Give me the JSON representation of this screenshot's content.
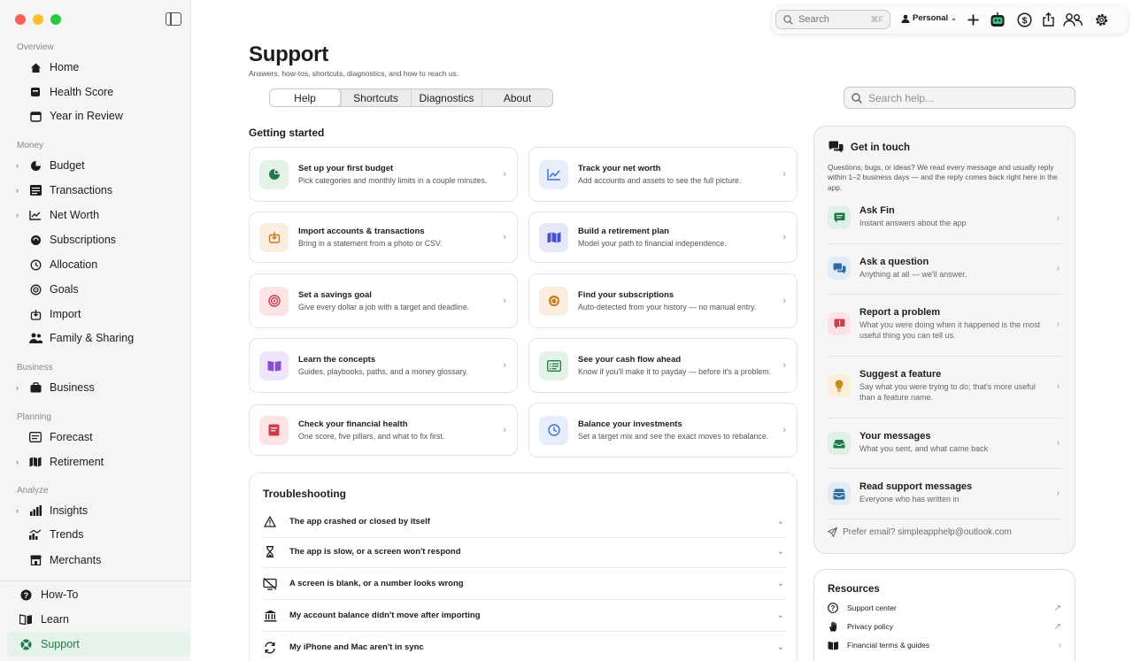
{
  "window": {
    "title": "Support"
  },
  "toolbar": {
    "search_label": "Search",
    "search_shortcut": "⌘F",
    "profile_label": "Personal"
  },
  "sidebar": {
    "sections": {
      "overview": "Overview",
      "money": "Money",
      "business": "Business",
      "planning": "Planning",
      "analyze": "Analyze"
    },
    "items": {
      "home": "Home",
      "health_score": "Health Score",
      "year_in_review": "Year in Review",
      "budget": "Budget",
      "transactions": "Transactions",
      "net_worth": "Net Worth",
      "subscriptions": "Subscriptions",
      "allocation": "Allocation",
      "goals": "Goals",
      "import": "Import",
      "family_sharing": "Family & Sharing",
      "business": "Business",
      "forecast": "Forecast",
      "retirement": "Retirement",
      "insights": "Insights",
      "trends": "Trends",
      "merchants": "Merchants"
    },
    "bottom": {
      "how_to": "How-To",
      "learn": "Learn",
      "support": "Support"
    }
  },
  "page": {
    "title": "Support",
    "subtitle": "Answers, how-tos, shortcuts, diagnostics, and how to reach us.",
    "tabs": [
      "Help",
      "Shortcuts",
      "Diagnostics",
      "About"
    ],
    "active_tab": "Help",
    "search_placeholder": "Search help..."
  },
  "getting_started": {
    "title": "Getting started",
    "cards": [
      {
        "title": "Set up your first budget",
        "desc": "Pick categories and monthly limits in a couple minutes."
      },
      {
        "title": "Track your net worth",
        "desc": "Add accounts and assets to see the full picture."
      },
      {
        "title": "Import accounts & transactions",
        "desc": "Bring in a statement from a photo or CSV."
      },
      {
        "title": "Build a retirement plan",
        "desc": "Model your path to financial independence."
      },
      {
        "title": "Set a savings goal",
        "desc": "Give every dollar a job with a target and deadline."
      },
      {
        "title": "Find your subscriptions",
        "desc": "Auto-detected from your history — no manual entry."
      },
      {
        "title": "Learn the concepts",
        "desc": "Guides, playbooks, paths, and a money glossary."
      },
      {
        "title": "See your cash flow ahead",
        "desc": "Know if you'll make it to payday — before it's a problem."
      },
      {
        "title": "Check your financial health",
        "desc": "One score, five pillars, and what to fix first."
      },
      {
        "title": "Balance your investments",
        "desc": "Set a target mix and see the exact moves to rebalance."
      }
    ]
  },
  "troubleshooting": {
    "title": "Troubleshooting",
    "rows": [
      "The app crashed or closed by itself",
      "The app is slow, or a screen won't respond",
      "A screen is blank, or a number looks wrong",
      "My account balance didn't move after importing",
      "My iPhone and Mac aren't in sync"
    ]
  },
  "get_in_touch": {
    "title": "Get in touch",
    "description": "Questions, bugs, or ideas? We read every message and usually reply within 1–2 business days — and the reply comes back right here in the app.",
    "items": [
      {
        "title": "Ask Fin",
        "desc": "Instant answers about the app"
      },
      {
        "title": "Ask a question",
        "desc": "Anything at all — we'll answer."
      },
      {
        "title": "Report a problem",
        "desc": "What you were doing when it happened is the most useful thing you can tell us."
      },
      {
        "title": "Suggest a feature",
        "desc": "Say what you were trying to do; that's more useful than a feature name."
      },
      {
        "title": "Your messages",
        "desc": "What you sent, and what came back"
      },
      {
        "title": "Read support messages",
        "desc": "Everyone who has written in"
      }
    ],
    "email_text": "Prefer email? simpleapphelp@outlook.com"
  },
  "resources": {
    "title": "Resources",
    "items": [
      "Support center",
      "Privacy policy",
      "Financial terms & guides"
    ]
  },
  "colors": {
    "accent_green": "#1f7a45",
    "active_bg": "#e5f3ea"
  }
}
